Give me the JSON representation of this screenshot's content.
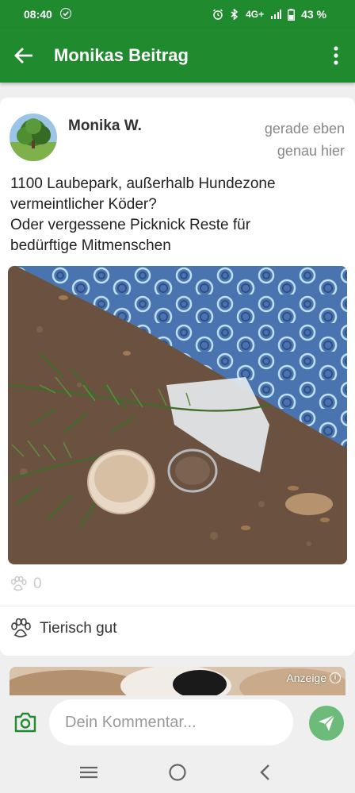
{
  "status_bar": {
    "time": "08:40",
    "network": "4G+",
    "battery": "43 %"
  },
  "app_bar": {
    "title": "Monikas Beitrag",
    "back_icon": "arrow-left-icon",
    "menu_icon": "more-vert-icon"
  },
  "post": {
    "author": "Monika W.",
    "time": "gerade eben",
    "location": "genau hier",
    "text_lines": [
      "1100 Laubepark, außerhalb Hundezone",
      "vermeintlicher Köder?",
      "Oder vergessene Picknick Reste für",
      "bedürftige Mitmenschen"
    ],
    "like_count": "0",
    "reaction_label": "Tierisch gut"
  },
  "ad": {
    "label": "Anzeige"
  },
  "composer": {
    "placeholder": "Dein Kommentar..."
  },
  "colors": {
    "primary": "#1f8a2e",
    "send_button": "#6dbb7a",
    "background": "#efefef"
  }
}
